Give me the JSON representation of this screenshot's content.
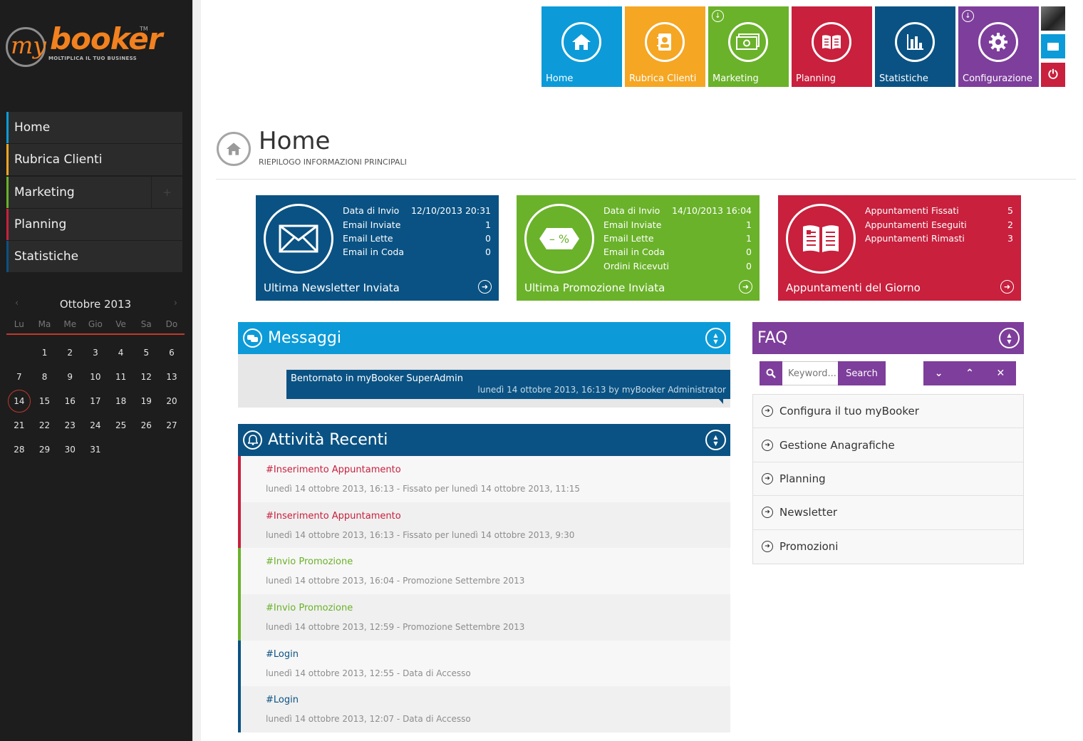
{
  "brand": {
    "my": "my",
    "booker": "booker",
    "tm": "TM",
    "tagline": "MOLTIPLICA IL TUO BUSINESS"
  },
  "sidebar": {
    "items": [
      {
        "label": "Home",
        "color": "#0c9bd8"
      },
      {
        "label": "Rubrica Clienti",
        "color": "#f5a623"
      },
      {
        "label": "Marketing",
        "color": "#6ab22a"
      },
      {
        "label": "Planning",
        "color": "#c8203d"
      },
      {
        "label": "Statistiche",
        "color": "#0a5283"
      }
    ],
    "marketing_expand": "+"
  },
  "calendar": {
    "month": "Ottobre 2013",
    "prev": "‹",
    "next": "›",
    "weekdays": [
      "Lu",
      "Ma",
      "Me",
      "Gio",
      "Ve",
      "Sa",
      "Do"
    ],
    "first_weekday_offset": 1,
    "days": [
      "1",
      "2",
      "3",
      "4",
      "5",
      "6",
      "7",
      "8",
      "9",
      "10",
      "11",
      "12",
      "13",
      "14",
      "15",
      "16",
      "17",
      "18",
      "19",
      "20",
      "21",
      "22",
      "23",
      "24",
      "25",
      "26",
      "27",
      "28",
      "29",
      "30",
      "31"
    ],
    "today": "14",
    "accent": "#c0392b"
  },
  "tiles": [
    {
      "label": "Home",
      "color": "#0c9bd8",
      "icon": "home-icon",
      "download": false
    },
    {
      "label": "Rubrica Clienti",
      "color": "#f5a623",
      "icon": "address-book-icon",
      "download": false
    },
    {
      "label": "Marketing",
      "color": "#6ab22a",
      "icon": "money-icon",
      "download": true
    },
    {
      "label": "Planning",
      "color": "#c8203d",
      "icon": "book-icon",
      "download": false
    },
    {
      "label": "Statistiche",
      "color": "#0a5283",
      "icon": "bar-chart-icon",
      "download": false
    },
    {
      "label": "Configurazione",
      "color": "#7e3e9b",
      "icon": "gear-icon",
      "download": true
    }
  ],
  "header": {
    "title": "Home",
    "subtitle": "RIEPILOGO INFORMAZIONI PRINCIPALI"
  },
  "stats": [
    {
      "color": "#0a5283",
      "icon": "envelope-icon",
      "rows": [
        {
          "label": "Data di Invio",
          "value": "12/10/2013 20:31"
        },
        {
          "label": "Email Inviate",
          "value": "1"
        },
        {
          "label": "Email Lette",
          "value": "0"
        },
        {
          "label": "Email in Coda",
          "value": "0"
        }
      ],
      "footer": "Ultima Newsletter Inviata"
    },
    {
      "color": "#6ab22a",
      "icon": "discount-tag-icon",
      "rows": [
        {
          "label": "Data di Invio",
          "value": "14/10/2013 16:04"
        },
        {
          "label": "Email Inviate",
          "value": "1"
        },
        {
          "label": "Email Lette",
          "value": "1"
        },
        {
          "label": "Email in Coda",
          "value": "0"
        },
        {
          "label": "Ordini Ricevuti",
          "value": "0"
        }
      ],
      "footer": "Ultima Promozione Inviata"
    },
    {
      "color": "#c8203d",
      "icon": "open-book-icon",
      "rows": [
        {
          "label": "Appuntamenti Fissati",
          "value": "5"
        },
        {
          "label": "Appuntamenti Eseguiti",
          "value": "2"
        },
        {
          "label": "Appuntamenti Rimasti",
          "value": "3"
        }
      ],
      "footer": "Appuntamenti del Giorno"
    }
  ],
  "messages": {
    "title": "Messaggi",
    "color": "#0c9bd8",
    "item": {
      "title": "Bentornato in myBooker SuperAdmin",
      "meta": "lunedì 14 ottobre 2013, 16:13 by myBooker Administrator"
    }
  },
  "activity": {
    "title": "Attività Recenti",
    "color": "#0a5283",
    "items": [
      {
        "title": "#Inserimento Appuntamento",
        "desc": "lunedì 14 ottobre 2013, 16:13 - Fissato per lunedì 14 ottobre 2013, 11:15",
        "color": "#c8203d"
      },
      {
        "title": "#Inserimento Appuntamento",
        "desc": "lunedì 14 ottobre 2013, 16:13 - Fissato per lunedì 14 ottobre 2013, 9:30",
        "color": "#c8203d"
      },
      {
        "title": "#Invio Promozione",
        "desc": "lunedì 14 ottobre 2013, 16:04 - Promozione Settembre 2013",
        "color": "#6ab22a"
      },
      {
        "title": "#Invio Promozione",
        "desc": "lunedì 14 ottobre 2013, 12:59 - Promozione Settembre 2013",
        "color": "#6ab22a"
      },
      {
        "title": "#Login",
        "desc": "lunedì 14 ottobre 2013, 12:55 - Data di Accesso",
        "color": "#0a5283"
      },
      {
        "title": "#Login",
        "desc": "lunedì 14 ottobre 2013, 12:07 - Data di Accesso",
        "color": "#0a5283"
      }
    ]
  },
  "faq": {
    "title": "FAQ",
    "color": "#7e3e9b",
    "search_placeholder": "Keyword...",
    "search_button": "Search",
    "controls": [
      "⌄",
      "⌃",
      "✕"
    ],
    "items": [
      "Configura il tuo myBooker",
      "Gestione Anagrafiche",
      "Planning",
      "Newsletter",
      "Promozioni"
    ]
  }
}
